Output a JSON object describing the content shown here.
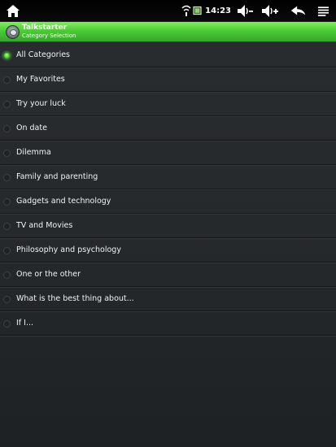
{
  "statusbar": {
    "time": "14:23",
    "icons": [
      "home-icon",
      "wifi-icon",
      "screenshot-icon",
      "volume-down-icon",
      "volume-up-icon",
      "back-icon",
      "menu-icon"
    ]
  },
  "titlebar": {
    "title": "Talkstarter",
    "subtitle": "Category Selection"
  },
  "categories": [
    {
      "label": "All Categories",
      "selected": true
    },
    {
      "label": "My Favorites",
      "selected": false
    },
    {
      "label": "Try your luck",
      "selected": false
    },
    {
      "label": "On date",
      "selected": false
    },
    {
      "label": "Dilemma",
      "selected": false
    },
    {
      "label": "Family and parenting",
      "selected": false
    },
    {
      "label": "Gadgets and technology",
      "selected": false
    },
    {
      "label": "TV and Movies",
      "selected": false
    },
    {
      "label": "Philosophy and psychology",
      "selected": false
    },
    {
      "label": "One or the other",
      "selected": false
    },
    {
      "label": "What is the best thing about...",
      "selected": false
    },
    {
      "label": "If I...",
      "selected": false
    }
  ],
  "colors": {
    "accent": "#4ccb36",
    "background": "#25282b",
    "statusbar": "#000000"
  }
}
